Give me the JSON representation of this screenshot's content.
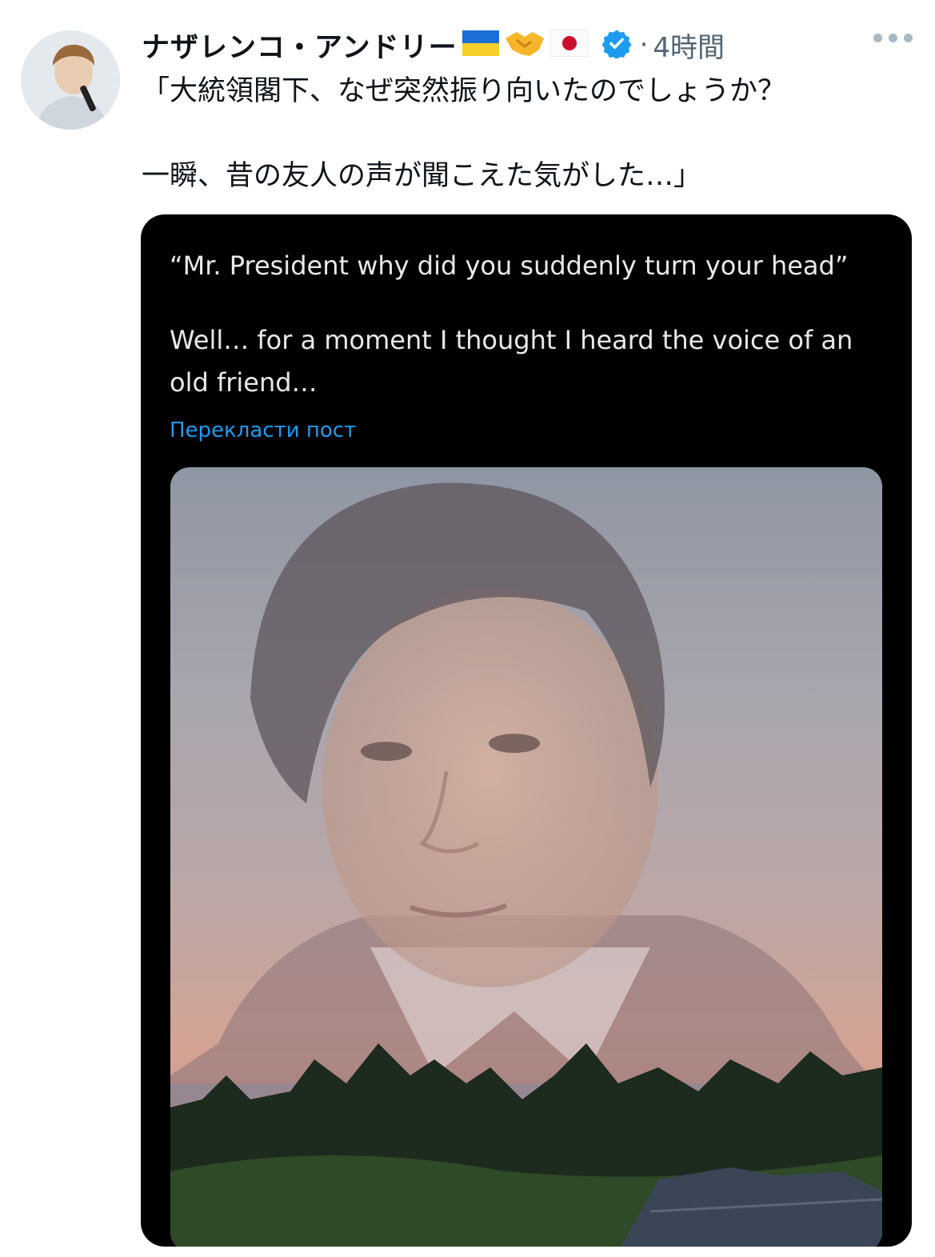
{
  "tweet": {
    "display_name": "ナザレンコ・アンドリー",
    "emojis": [
      "ukraine-flag",
      "handshake",
      "japan-flag"
    ],
    "separator": "·",
    "time": "4時間",
    "text_line1": "「大統領閣下、なぜ突然振り向いたのでしょうか？",
    "text_line2": "一瞬、昔の友人の声が聞こえた気がした…」"
  },
  "quoted": {
    "line1": "“Mr. President why did you suddenly turn your head”",
    "line2": "Well… for a moment I thought I heard the voice of an old friend…",
    "translate": "Перекласти пост"
  },
  "colors": {
    "verified": "#1d9bf0",
    "link": "#1d9bf0",
    "card_bg": "#000000"
  }
}
